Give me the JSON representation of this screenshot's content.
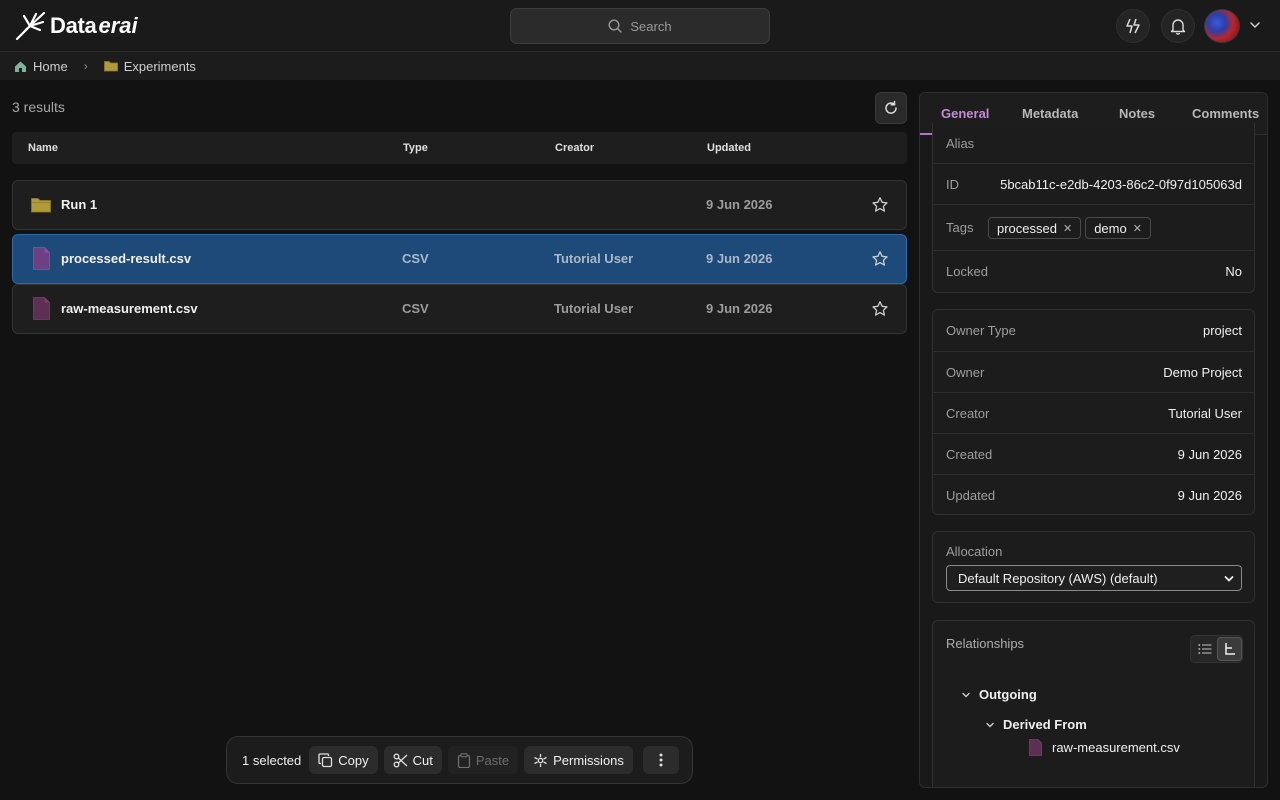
{
  "app": {
    "logo_main": "Data",
    "logo_italic": "erai"
  },
  "search": {
    "placeholder": "Search"
  },
  "breadcrumb": {
    "items": [
      "Home",
      "Experiments"
    ]
  },
  "results": {
    "count_text": "3 results"
  },
  "table": {
    "columns": [
      "Name",
      "Type",
      "Creator",
      "Updated"
    ],
    "rows": [
      {
        "name": "Run 1",
        "type": "",
        "creator": "",
        "updated": "9 Jun 2026",
        "icon": "folder-icon"
      },
      {
        "name": "processed-result.csv",
        "type": "CSV",
        "creator": "Tutorial User",
        "updated": "9 Jun 2026",
        "icon": "file-icon"
      },
      {
        "name": "raw-measurement.csv",
        "type": "CSV",
        "creator": "Tutorial User",
        "updated": "9 Jun 2026",
        "icon": "file-icon"
      }
    ]
  },
  "actionbar": {
    "selected_text": "1 selected",
    "copy": "Copy",
    "cut": "Cut",
    "paste": "Paste",
    "permissions": "Permissions"
  },
  "panel": {
    "tabs": [
      "General",
      "Metadata",
      "Notes",
      "Comments"
    ],
    "general": {
      "alias_label": "Alias",
      "id_label": "ID",
      "id_value": "5bcab11c-e2db-4203-86c2-0f97d105063d",
      "tags_label": "Tags",
      "tags": [
        "processed",
        "demo"
      ],
      "locked_label": "Locked",
      "locked_value": "No",
      "owner_type_label": "Owner Type",
      "owner_type_value": "project",
      "owner_label": "Owner",
      "owner_value": "Demo Project",
      "creator_label": "Creator",
      "creator_value": "Tutorial User",
      "created_label": "Created",
      "created_value": "9 Jun 2026",
      "updated_label": "Updated",
      "updated_value": "9 Jun 2026",
      "allocation_label": "Allocation",
      "allocation_value": "Default Repository (AWS) (default)",
      "relationships_label": "Relationships",
      "outgoing_label": "Outgoing",
      "derived_from_label": "Derived From",
      "derived_file": "raw-measurement.csv"
    }
  },
  "colors": {
    "accent_purple": "#b672cf",
    "selected_row": "#1d4a78",
    "folder": "#b09a3a",
    "csv_file": "#7b3f8e"
  }
}
